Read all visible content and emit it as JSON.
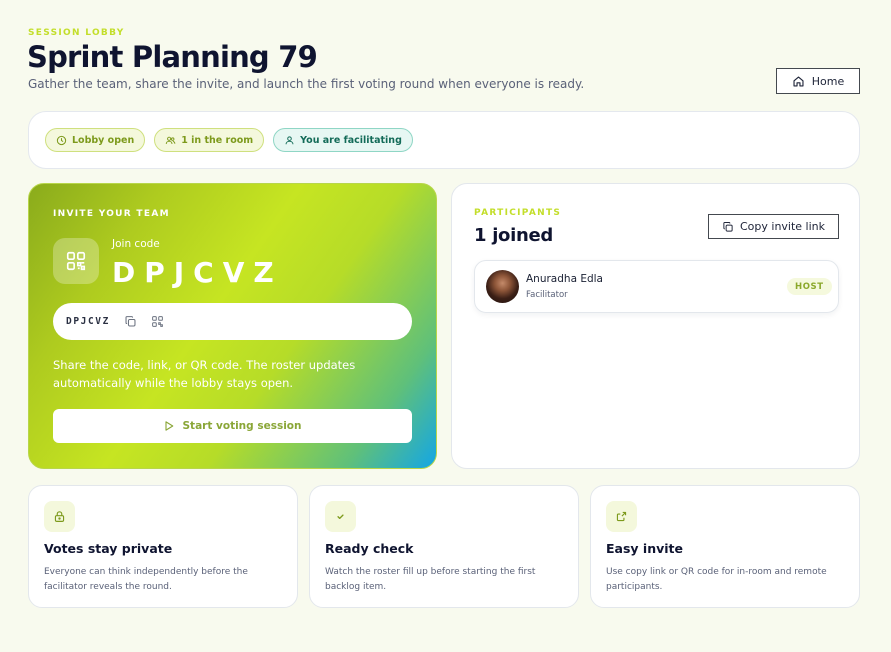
{
  "header": {
    "eyebrow": "SESSION LOBBY",
    "title": "Sprint Planning 79",
    "subtitle": "Gather the team, share the invite, and launch the first voting round when everyone is ready.",
    "home_label": "Home"
  },
  "status": {
    "pills": [
      {
        "label": "Lobby open",
        "icon": "clock-icon"
      },
      {
        "label": "1 in the room",
        "icon": "users-icon"
      },
      {
        "label": "You are facilitating",
        "icon": "user-icon"
      }
    ]
  },
  "invite": {
    "eyebrow": "INVITE YOUR TEAM",
    "join_label": "Join code",
    "join_code": "DPJCVZ",
    "field_code": "DPJCVZ",
    "help_text": "Share the code, link, or QR code. The roster updates automatically while the lobby stays open.",
    "start_label": "Start voting session"
  },
  "participants": {
    "eyebrow": "PARTICIPANTS",
    "count_label": "1 joined",
    "copy_label": "Copy invite link",
    "list": [
      {
        "name": "Anuradha Edla",
        "role": "Facilitator",
        "badge": "HOST"
      }
    ]
  },
  "features": [
    {
      "title": "Votes stay private",
      "desc": "Everyone can think independently before the facilitator reveals the round.",
      "icon": "lock-icon"
    },
    {
      "title": "Ready check",
      "desc": "Watch the roster fill up before starting the first backlog item.",
      "icon": "check-icon"
    },
    {
      "title": "Easy invite",
      "desc": "Use copy link or QR code for in-room and remote participants.",
      "icon": "share-icon"
    }
  ],
  "colors": {
    "accent": "#c3de2a",
    "background": "#f8faee",
    "teal": "#136b58"
  }
}
